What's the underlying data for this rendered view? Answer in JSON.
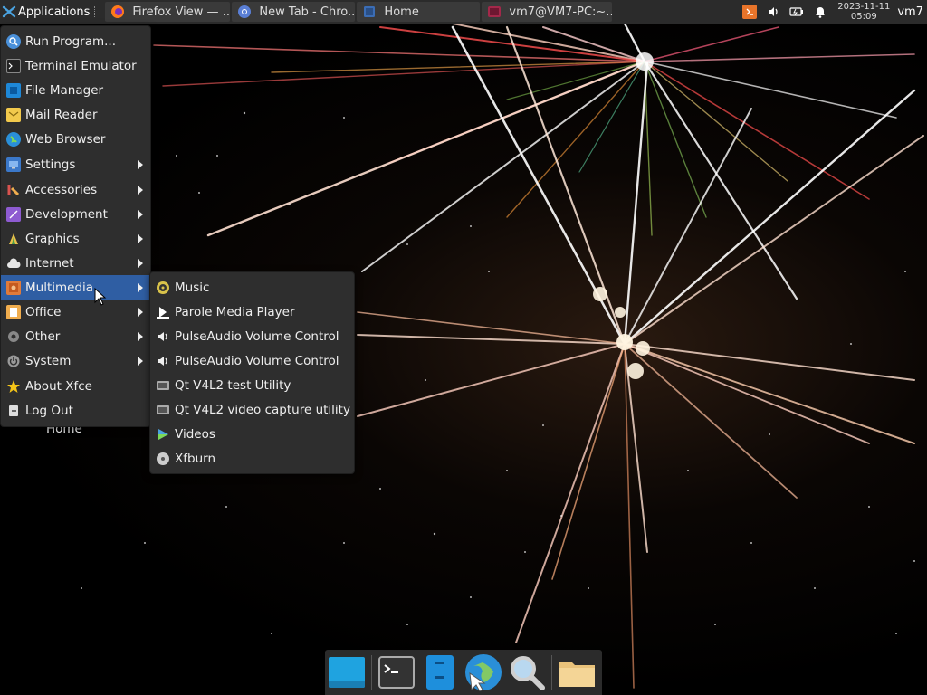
{
  "top_panel": {
    "applications_label": "Applications",
    "tasks": [
      {
        "label": "Firefox View — ...",
        "icon": "firefox-icon"
      },
      {
        "label": "New Tab - Chro...",
        "icon": "chromium-icon"
      },
      {
        "label": "Home",
        "icon": "folder-icon"
      },
      {
        "label": "vm7@VM7-PC:~...",
        "icon": "terminal-icon"
      }
    ],
    "clock_date": "2023-11-11",
    "clock_time": "05:09",
    "user": "vm7"
  },
  "main_menu": {
    "items": [
      {
        "label": "Run Program...",
        "icon": "run-icon",
        "submenu": false
      },
      {
        "label": "Terminal Emulator",
        "icon": "terminal-icon",
        "submenu": false
      },
      {
        "label": "File Manager",
        "icon": "file-manager-icon",
        "submenu": false
      },
      {
        "label": "Mail Reader",
        "icon": "mail-icon",
        "submenu": false
      },
      {
        "label": "Web Browser",
        "icon": "web-browser-icon",
        "submenu": false
      },
      {
        "label": "Settings",
        "icon": "settings-icon",
        "submenu": true
      },
      {
        "label": "Accessories",
        "icon": "accessories-icon",
        "submenu": true
      },
      {
        "label": "Development",
        "icon": "development-icon",
        "submenu": true
      },
      {
        "label": "Graphics",
        "icon": "graphics-icon",
        "submenu": true
      },
      {
        "label": "Internet",
        "icon": "internet-icon",
        "submenu": true
      },
      {
        "label": "Multimedia",
        "icon": "multimedia-icon",
        "submenu": true
      },
      {
        "label": "Office",
        "icon": "office-icon",
        "submenu": true
      },
      {
        "label": "Other",
        "icon": "other-icon",
        "submenu": true
      },
      {
        "label": "System",
        "icon": "system-icon",
        "submenu": true
      },
      {
        "label": "About Xfce",
        "icon": "star-icon",
        "submenu": false
      },
      {
        "label": "Log Out",
        "icon": "logout-icon",
        "submenu": false
      }
    ]
  },
  "multimedia_submenu": {
    "items": [
      {
        "label": "Music",
        "icon": "music-icon"
      },
      {
        "label": "Parole Media Player",
        "icon": "parole-icon"
      },
      {
        "label": "PulseAudio Volume Control",
        "icon": "speaker-icon"
      },
      {
        "label": "PulseAudio Volume Control",
        "icon": "speaker-icon"
      },
      {
        "label": "Qt V4L2 test Utility",
        "icon": "webcam-icon"
      },
      {
        "label": "Qt V4L2 video capture utility",
        "icon": "webcam-icon"
      },
      {
        "label": "Videos",
        "icon": "videos-icon"
      },
      {
        "label": "Xfburn",
        "icon": "disc-icon"
      }
    ]
  },
  "desktop": {
    "home_label": "Home"
  },
  "dock": {
    "items": [
      "show-desktop-icon",
      "terminal-icon",
      "file-manager-icon",
      "web-browser-icon",
      "search-icon",
      "folder-icon"
    ]
  },
  "colors": {
    "panel": "#2b2b2b",
    "menu": "#2e2e2e",
    "highlight": "#2f5ea3"
  }
}
